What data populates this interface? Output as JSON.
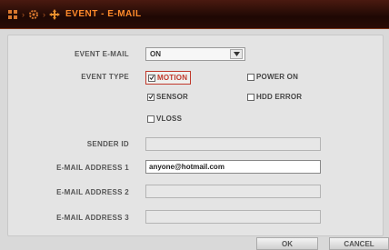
{
  "titlebar": {
    "title": "EVENT - E-MAIL",
    "breadcrumb_icons": [
      "grid-icon",
      "gear-icon",
      "move-icon"
    ]
  },
  "form": {
    "event_email": {
      "label": "EVENT E-MAIL",
      "value": "ON"
    },
    "event_type": {
      "label": "EVENT TYPE",
      "options": [
        {
          "label": "MOTION",
          "checked": true
        },
        {
          "label": "POWER ON",
          "checked": false
        },
        {
          "label": "SENSOR",
          "checked": true
        },
        {
          "label": "HDD ERROR",
          "checked": false
        },
        {
          "label": "VLOSS",
          "checked": false
        }
      ]
    },
    "sender_id": {
      "label": "SENDER ID",
      "value": ""
    },
    "email_1": {
      "label": "E-MAIL ADDRESS 1",
      "value": "anyone@hotmail.com"
    },
    "email_2": {
      "label": "E-MAIL ADDRESS 2",
      "value": ""
    },
    "email_3": {
      "label": "E-MAIL ADDRESS 3",
      "value": ""
    }
  },
  "buttons": {
    "ok": "OK",
    "cancel": "CANCEL"
  },
  "colors": {
    "accent": "#ff8a2a",
    "highlight_border": "#c0392b"
  }
}
